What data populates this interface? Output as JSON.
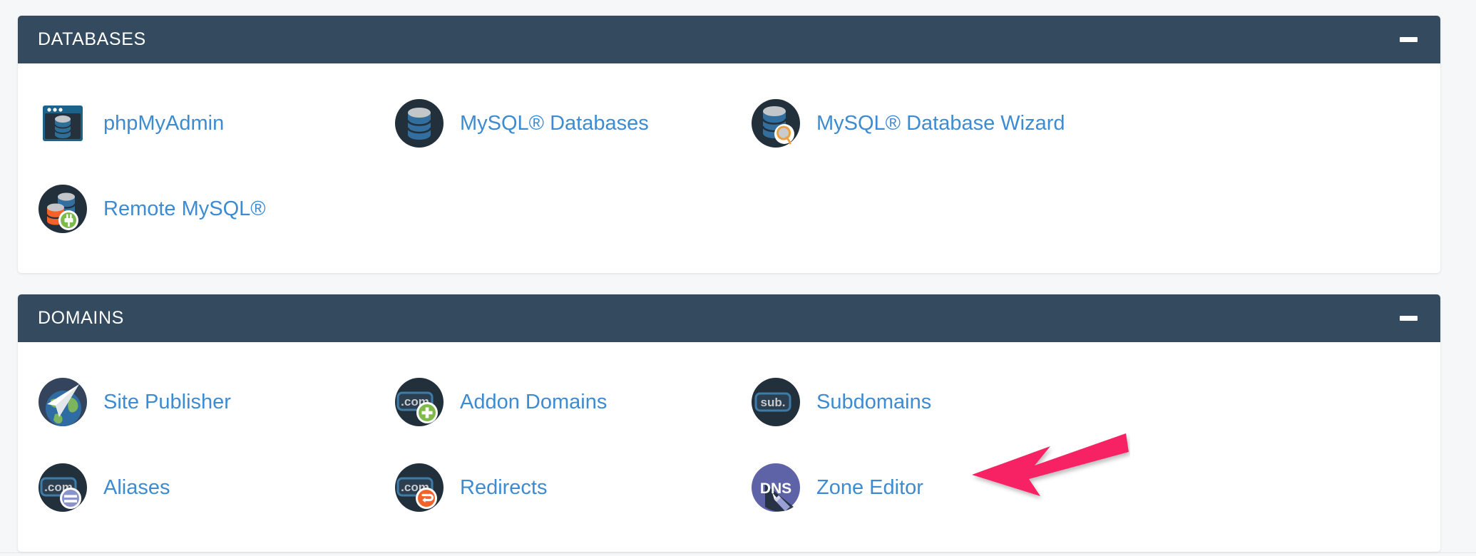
{
  "theme": {
    "page_background": "#f6f7f8",
    "panel_background": "#ffffff",
    "header_background": "#344a5f",
    "link_color": "#3d8bd1",
    "annotation_color": "#f72163"
  },
  "panels": [
    {
      "title": "DATABASES",
      "collapse_icon": "minus-icon",
      "items": [
        {
          "label": "phpMyAdmin",
          "icon": "phpmyadmin-icon"
        },
        {
          "label": "MySQL® Databases",
          "icon": "mysql-databases-icon"
        },
        {
          "label": "MySQL® Database Wizard",
          "icon": "mysql-database-wizard-icon"
        },
        {
          "label": "Remote MySQL®",
          "icon": "remote-mysql-icon"
        }
      ]
    },
    {
      "title": "DOMAINS",
      "collapse_icon": "minus-icon",
      "items": [
        {
          "label": "Site Publisher",
          "icon": "site-publisher-icon"
        },
        {
          "label": "Addon Domains",
          "icon": "addon-domains-icon"
        },
        {
          "label": "Subdomains",
          "icon": "subdomains-icon"
        },
        {
          "label": "Aliases",
          "icon": "aliases-icon"
        },
        {
          "label": "Redirects",
          "icon": "redirects-icon"
        },
        {
          "label": "Zone Editor",
          "icon": "zone-editor-icon"
        }
      ]
    }
  ],
  "icon_text": {
    "dotcom": ".com",
    "sub": "sub.",
    "dns": "DNS"
  },
  "annotation": {
    "type": "arrow",
    "points_to": "Zone Editor",
    "color": "#f72163"
  }
}
